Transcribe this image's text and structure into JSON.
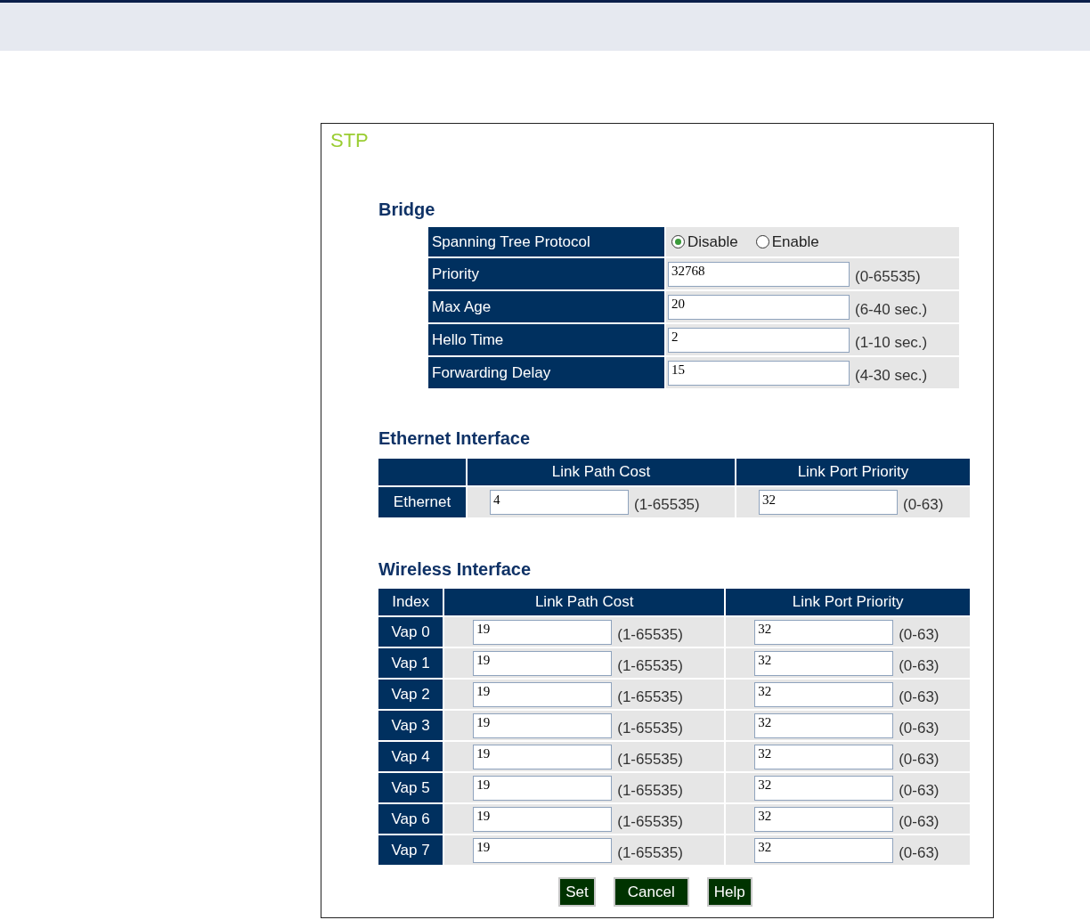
{
  "title": "STP",
  "bridge": {
    "heading": "Bridge",
    "rows": [
      {
        "kind": "radio",
        "label": "Spanning Tree Protocol",
        "options": [
          {
            "label": "Disable",
            "selected": true
          },
          {
            "label": "Enable",
            "selected": false
          }
        ]
      },
      {
        "kind": "input",
        "label": "Priority",
        "value": "32768",
        "range": "(0-65535)"
      },
      {
        "kind": "input",
        "label": "Max Age",
        "value": "20",
        "range": "(6-40 sec.)"
      },
      {
        "kind": "input",
        "label": "Hello Time",
        "value": "2",
        "range": "(1-10 sec.)"
      },
      {
        "kind": "input",
        "label": "Forwarding Delay",
        "value": "15",
        "range": "(4-30 sec.)"
      }
    ]
  },
  "ethernet": {
    "heading": "Ethernet Interface",
    "columns": [
      "Link Path Cost",
      "Link Port Priority"
    ],
    "rows": [
      {
        "name": "Ethernet",
        "path_cost": "4",
        "path_cost_range": "(1-65535)",
        "port_priority": "32",
        "port_priority_range": "(0-63)"
      }
    ]
  },
  "wireless": {
    "heading": "Wireless Interface",
    "columns": [
      "Index",
      "Link Path Cost",
      "Link Port Priority"
    ],
    "rows": [
      {
        "name": "Vap 0",
        "path_cost": "19",
        "path_cost_range": "(1-65535)",
        "port_priority": "32",
        "port_priority_range": "(0-63)"
      },
      {
        "name": "Vap 1",
        "path_cost": "19",
        "path_cost_range": "(1-65535)",
        "port_priority": "32",
        "port_priority_range": "(0-63)"
      },
      {
        "name": "Vap 2",
        "path_cost": "19",
        "path_cost_range": "(1-65535)",
        "port_priority": "32",
        "port_priority_range": "(0-63)"
      },
      {
        "name": "Vap 3",
        "path_cost": "19",
        "path_cost_range": "(1-65535)",
        "port_priority": "32",
        "port_priority_range": "(0-63)"
      },
      {
        "name": "Vap 4",
        "path_cost": "19",
        "path_cost_range": "(1-65535)",
        "port_priority": "32",
        "port_priority_range": "(0-63)"
      },
      {
        "name": "Vap 5",
        "path_cost": "19",
        "path_cost_range": "(1-65535)",
        "port_priority": "32",
        "port_priority_range": "(0-63)"
      },
      {
        "name": "Vap 6",
        "path_cost": "19",
        "path_cost_range": "(1-65535)",
        "port_priority": "32",
        "port_priority_range": "(0-63)"
      },
      {
        "name": "Vap 7",
        "path_cost": "19",
        "path_cost_range": "(1-65535)",
        "port_priority": "32",
        "port_priority_range": "(0-63)"
      }
    ]
  },
  "buttons": [
    "Set",
    "Cancel",
    "Help"
  ]
}
